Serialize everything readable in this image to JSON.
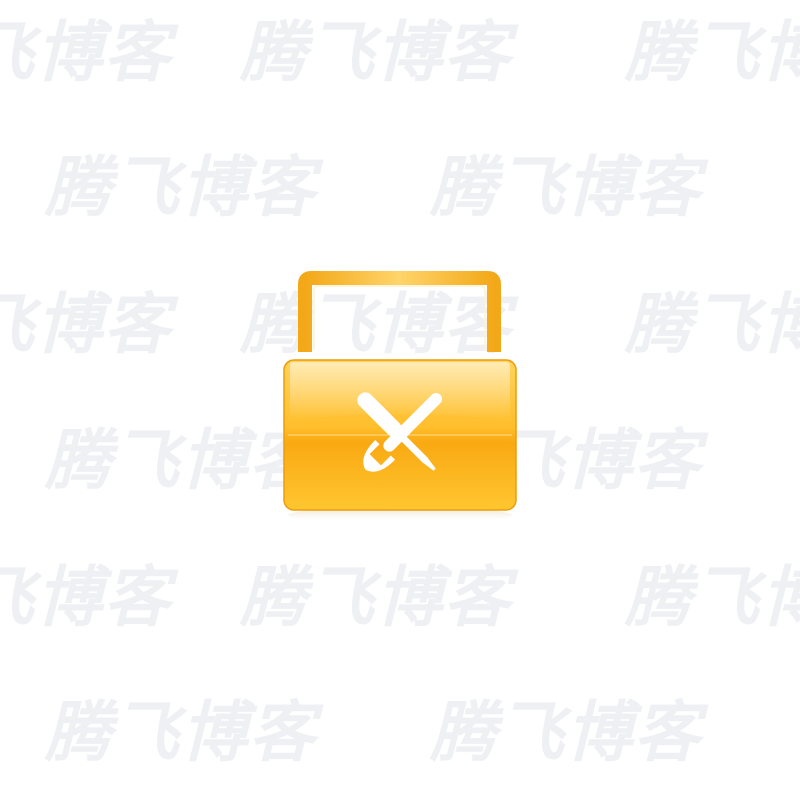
{
  "watermark": {
    "text": "腾飞博客",
    "color": "#eef0f4"
  },
  "icon": {
    "name": "toolbox-icon",
    "tools": [
      "wrench-icon",
      "screwdriver-icon"
    ],
    "colors": {
      "body_top": "#ffc23a",
      "body_bottom": "#f7a40f",
      "handle": "#f6b21f",
      "tool": "#ffffff"
    }
  }
}
